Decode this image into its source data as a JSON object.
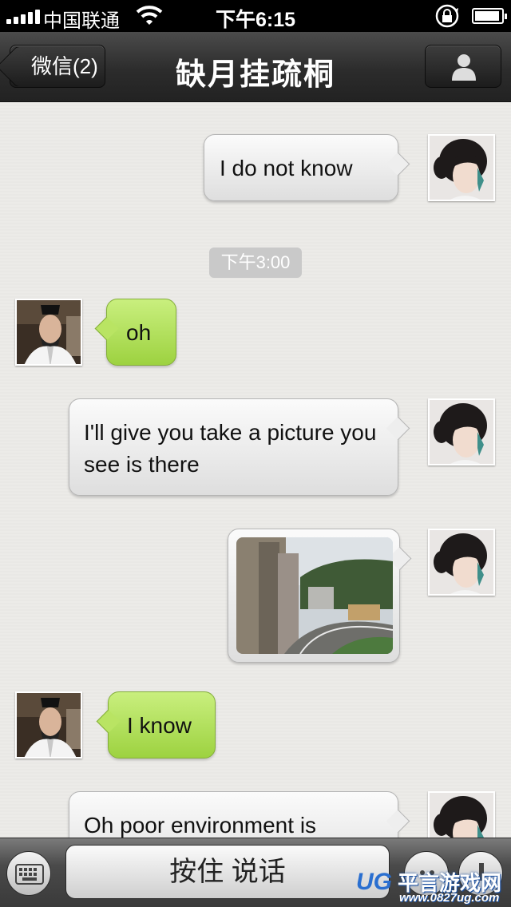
{
  "status_bar": {
    "carrier": "中国联通",
    "time": "下午6:15",
    "battery_level": 0.95
  },
  "nav": {
    "back_label": "微信(2)",
    "title": "缺月挂疏桐"
  },
  "messages": [
    {
      "side": "me",
      "text": "I do not know"
    },
    {
      "side": "timestamp",
      "text": "下午3:00"
    },
    {
      "side": "them",
      "text": "oh"
    },
    {
      "side": "me",
      "text": "I'll give you take a picture you see is there"
    },
    {
      "side": "me",
      "type": "image"
    },
    {
      "side": "them",
      "text": "I know"
    },
    {
      "side": "me",
      "text": "Oh poor environment is"
    }
  ],
  "input_bar": {
    "talk_label": "按住 说话"
  },
  "watermark": {
    "brand": "UG",
    "name": "平言游戏网",
    "url": "www.0827ug.com"
  },
  "icons": [
    "signal-icon",
    "wifi-icon",
    "rotation-lock-icon",
    "battery-icon",
    "person-icon",
    "keyboard-icon",
    "emoji-icon",
    "plus-icon"
  ],
  "colors": {
    "nav_bar": "#2c2c2c",
    "bubble_them": "#a8dc50",
    "bubble_me": "#f0f0f0",
    "chat_bg": "#ecebe8"
  }
}
